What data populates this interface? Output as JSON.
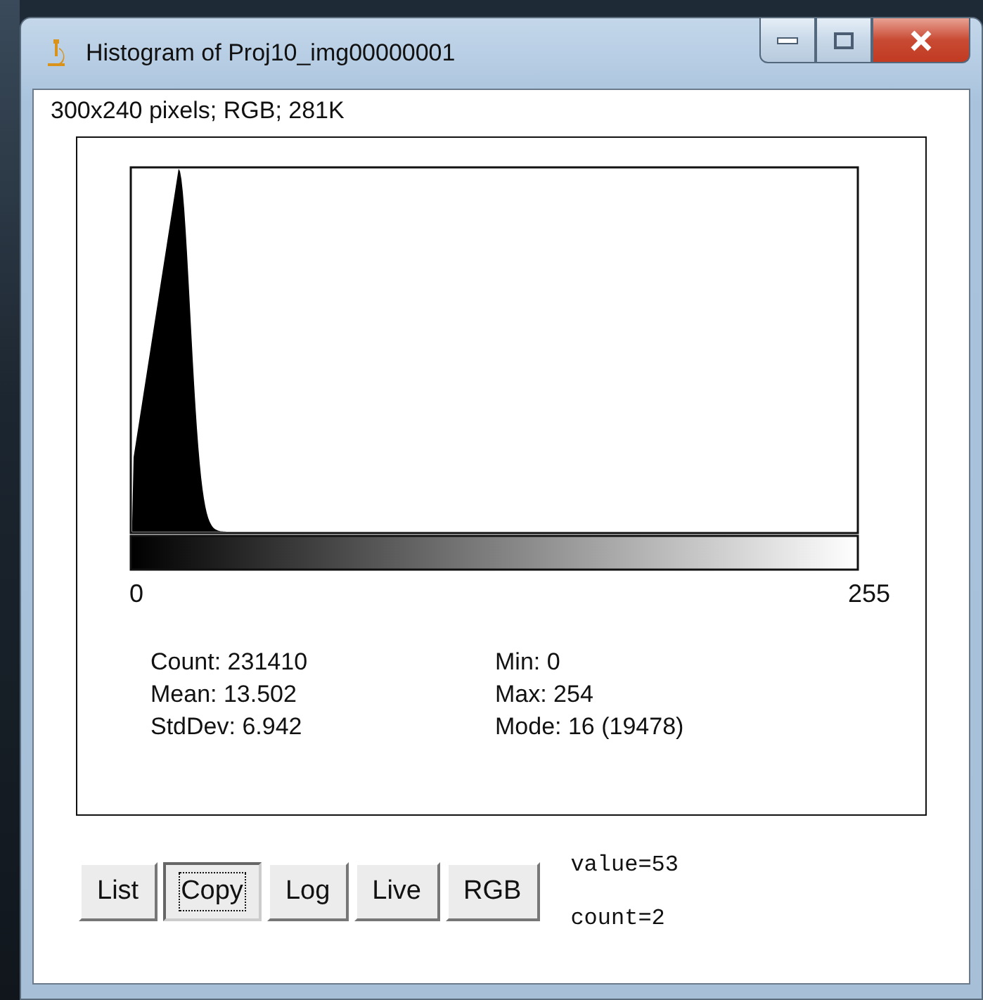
{
  "window": {
    "title": "Histogram of Proj10_img00000001"
  },
  "image_info": "300x240 pixels; RGB; 281K",
  "axis_labels": [
    "0",
    "255"
  ],
  "stats_left": [
    "Count: 231410",
    "Mean: 13.502",
    "StdDev: 6.942"
  ],
  "stats_right": [
    "Min: 0",
    "Max: 254",
    "Mode: 16 (19478)"
  ],
  "buttons": [
    {
      "label": "List",
      "selected": false
    },
    {
      "label": "Copy",
      "selected": true
    },
    {
      "label": "Log",
      "selected": false
    },
    {
      "label": "Live",
      "selected": false
    },
    {
      "label": "RGB",
      "selected": false
    }
  ],
  "readout": [
    "value=53",
    "count=2"
  ]
}
